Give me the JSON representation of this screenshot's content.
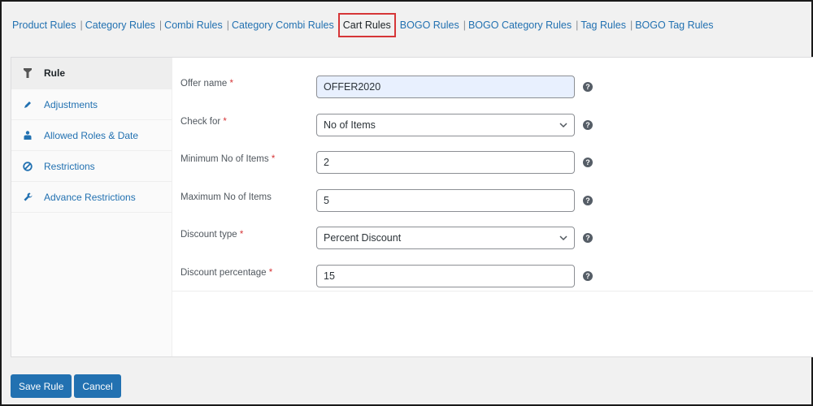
{
  "tabs": [
    {
      "label": "Product Rules",
      "active": false
    },
    {
      "label": "Category Rules",
      "active": false
    },
    {
      "label": "Combi Rules",
      "active": false
    },
    {
      "label": "Category Combi Rules",
      "active": false
    },
    {
      "label": "Cart Rules",
      "active": true
    },
    {
      "label": "BOGO Rules",
      "active": false
    },
    {
      "label": "BOGO Category Rules",
      "active": false
    },
    {
      "label": "Tag Rules",
      "active": false
    },
    {
      "label": "BOGO Tag Rules",
      "active": false
    }
  ],
  "tab_separator": "|",
  "sidebar": {
    "items": [
      {
        "label": "Rule",
        "icon": "filter-icon",
        "active": true
      },
      {
        "label": "Adjustments",
        "icon": "pencil-icon",
        "active": false
      },
      {
        "label": "Allowed Roles & Date",
        "icon": "users-icon",
        "active": false
      },
      {
        "label": "Restrictions",
        "icon": "ban-icon",
        "active": false
      },
      {
        "label": "Advance Restrictions",
        "icon": "wrench-icon",
        "active": false
      }
    ]
  },
  "form": {
    "required_marker": "*",
    "fields": [
      {
        "label": "Offer name",
        "required": true,
        "type": "text",
        "value": "OFFER2020",
        "focused": true
      },
      {
        "label": "Check for",
        "required": true,
        "type": "select",
        "value": "No of Items"
      },
      {
        "label": "Minimum No of Items",
        "required": true,
        "type": "text",
        "value": "2"
      },
      {
        "label": "Maximum No of Items",
        "required": false,
        "type": "text",
        "value": "5"
      },
      {
        "label": "Discount type",
        "required": true,
        "type": "select",
        "value": "Percent Discount"
      },
      {
        "label": "Discount percentage",
        "required": true,
        "type": "text",
        "value": "15"
      }
    ],
    "help_glyph": "?"
  },
  "buttons": {
    "save_label": "Save Rule",
    "cancel_label": "Cancel"
  },
  "colors": {
    "accent": "#2271b1",
    "active_tab_border": "#d63638",
    "required": "#d63638",
    "focused_field": "#e8f0fe"
  }
}
